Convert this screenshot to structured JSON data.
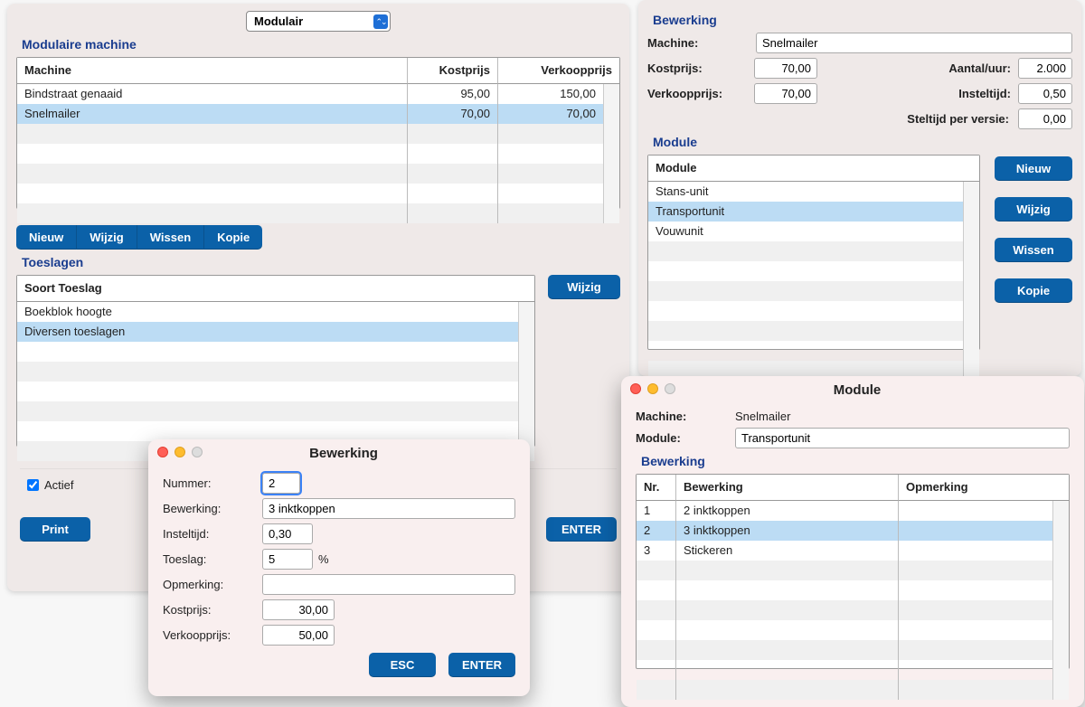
{
  "combo": {
    "value": "Modulair"
  },
  "modMachine": {
    "title": "Modulaire machine",
    "headers": [
      "Machine",
      "Kostprijs",
      "Verkoopprijs"
    ],
    "rows": [
      {
        "name": "Bindstraat genaaid",
        "cost": "95,00",
        "sell": "150,00"
      },
      {
        "name": "Snelmailer",
        "cost": "70,00",
        "sell": "70,00"
      }
    ],
    "buttons": {
      "new": "Nieuw",
      "edit": "Wijzig",
      "delete": "Wissen",
      "copy": "Kopie"
    }
  },
  "toeslagen": {
    "title": "Toeslagen",
    "header": "Soort Toeslag",
    "rows": [
      "Boekblok hoogte",
      "Diversen toeslagen"
    ],
    "editBtn": "Wijzig"
  },
  "actief": {
    "label": "Actief",
    "checked": true
  },
  "footerButtons": {
    "print": "Print",
    "enter": "ENTER"
  },
  "bewerking": {
    "title": "Bewerking",
    "labels": {
      "machine": "Machine:",
      "kostprijs": "Kostprijs:",
      "verkoop": "Verkoopprijs:",
      "aantal": "Aantal/uur:",
      "instel": "Insteltijd:",
      "stel": "Steltijd per versie:"
    },
    "values": {
      "machine": "Snelmailer",
      "kostprijs": "70,00",
      "verkoop": "70,00",
      "aantal": "2.000",
      "instel": "0,50",
      "stel": "0,00"
    }
  },
  "module": {
    "title": "Module",
    "header": "Module",
    "rows": [
      "Stans-unit",
      "Transportunit",
      "Vouwunit"
    ],
    "buttons": {
      "new": "Nieuw",
      "edit": "Wijzig",
      "delete": "Wissen",
      "copy": "Kopie"
    }
  },
  "bewerkingDialog": {
    "title": "Bewerking",
    "labels": {
      "nummer": "Nummer:",
      "bewerking": "Bewerking:",
      "instel": "Insteltijd:",
      "toeslag": "Toeslag:",
      "opmerking": "Opmerking:",
      "kostprijs": "Kostprijs:",
      "verkoop": "Verkoopprijs:",
      "percent": "%"
    },
    "values": {
      "nummer": "2",
      "bewerking": "3 inktkoppen",
      "instel": "0,30",
      "toeslag": "5",
      "opmerking": "",
      "kostprijs": "30,00",
      "verkoop": "50,00"
    },
    "buttons": {
      "esc": "ESC",
      "enter": "ENTER"
    }
  },
  "moduleDialog": {
    "title": "Module",
    "labels": {
      "machine": "Machine:",
      "module": "Module:",
      "section": "Bewerking"
    },
    "values": {
      "machine": "Snelmailer",
      "module": "Transportunit"
    },
    "headers": [
      "Nr.",
      "Bewerking",
      "Opmerking"
    ],
    "rows": [
      {
        "nr": "1",
        "bew": "2 inktkoppen",
        "opm": ""
      },
      {
        "nr": "2",
        "bew": "3 inktkoppen",
        "opm": ""
      },
      {
        "nr": "3",
        "bew": "Stickeren",
        "opm": ""
      }
    ]
  }
}
